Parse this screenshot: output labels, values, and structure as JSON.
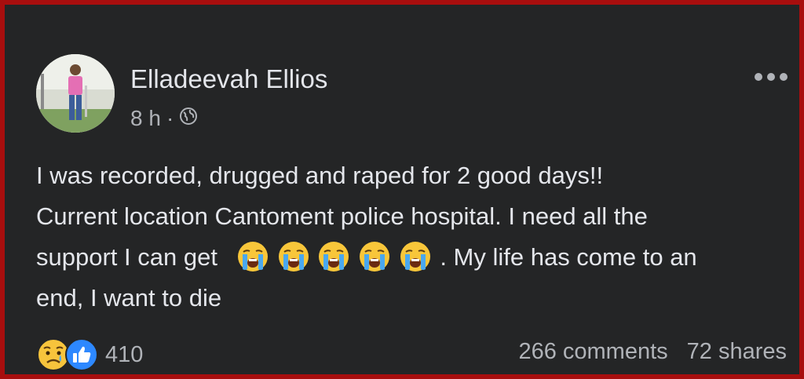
{
  "post": {
    "author": "Elladeevah Ellios",
    "time": "8 h",
    "separator": "·",
    "audience_icon": "globe-icon",
    "more_icon": "more-horizontal-icon",
    "text_lines": [
      "I was recorded, drugged and raped for 2 good days!!",
      "Current location Cantoment police hospital. I need all the",
      "support I can get",
      ".  My life has come to an",
      "end, I want to die"
    ],
    "inline_emoji": "loudly-crying-face-icon",
    "inline_emoji_count": 5
  },
  "footer": {
    "reaction_icons": [
      "sad-face-icon",
      "like-icon"
    ],
    "reaction_count": "410",
    "comments": "266 comments",
    "shares": "72 shares"
  },
  "colors": {
    "frame_border": "#a80e0e",
    "background": "#242526",
    "primary_text": "#e4e6eb",
    "secondary_text": "#b0b3b8",
    "like_blue": "#2d88ff"
  }
}
